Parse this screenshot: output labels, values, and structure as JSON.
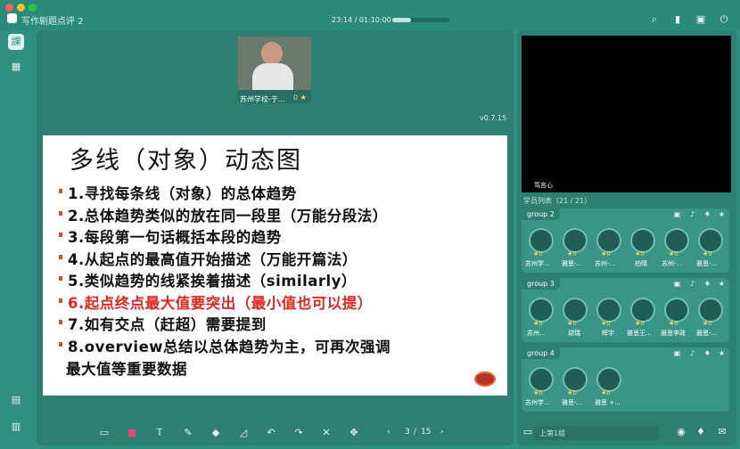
{
  "window": {
    "title": "写作剧题点评 2",
    "time": "23:14 / 01:10:00",
    "progress_fraction": 0.33
  },
  "teacher_tile": {
    "name": "苏州学校-于...",
    "score": "0"
  },
  "version": "v0.7.15",
  "slide": {
    "title": "多线（对象）动态图",
    "bullets": [
      {
        "text": "1.寻找每条线（对象）的总体趋势",
        "color": "black"
      },
      {
        "text": "2.总体趋势类似的放在同一段里（万能分段法）",
        "color": "black"
      },
      {
        "text": "3.每段第一句话概括本段的趋势",
        "color": "black"
      },
      {
        "text": "4.从起点的最高值开始描述（万能开篇法）",
        "color": "black"
      },
      {
        "text": "5.类似趋势的线紧挨着描述（similarly）",
        "color": "black"
      },
      {
        "text": "6.起点终点最大值要突出（最小值也可以提）",
        "color": "red"
      },
      {
        "text": "7.如有交点（赶超）需要提到",
        "color": "black"
      },
      {
        "text": "8.overview总结以总体趋势为主，可再次强调",
        "color": "black"
      },
      {
        "text": "最大值等重要数据",
        "color": "black"
      }
    ]
  },
  "pager": {
    "current": "3",
    "separator": "/",
    "total": "15"
  },
  "right_panel": {
    "teacher_label": "笃言心",
    "student_list_title": "学员列表（21 / 21）",
    "groups": [
      {
        "name": "group 2",
        "students": [
          {
            "name": "苏州学...",
            "score": "0"
          },
          {
            "name": "雅思-...",
            "score": "0"
          },
          {
            "name": "苏州-...",
            "score": "0"
          },
          {
            "name": "柏晴",
            "score": "0"
          },
          {
            "name": "苏州-...",
            "score": "0"
          },
          {
            "name": "雅思-...",
            "score": "0"
          }
        ]
      },
      {
        "name": "group 3",
        "students": [
          {
            "name": "苏州...",
            "score": "0"
          },
          {
            "name": "胡瑞",
            "score": "0"
          },
          {
            "name": "辉宇",
            "score": "0"
          },
          {
            "name": "雅思王...",
            "score": "0"
          },
          {
            "name": "雅思李政",
            "score": "0"
          },
          {
            "name": "雅思-...",
            "score": "0"
          }
        ]
      },
      {
        "name": "group 4",
        "students": [
          {
            "name": "苏州学...",
            "score": "0"
          },
          {
            "name": "雅思-...",
            "score": "0"
          },
          {
            "name": "雅思 +...",
            "score": "0"
          }
        ]
      }
    ],
    "chat_placeholder": "上第1组"
  }
}
